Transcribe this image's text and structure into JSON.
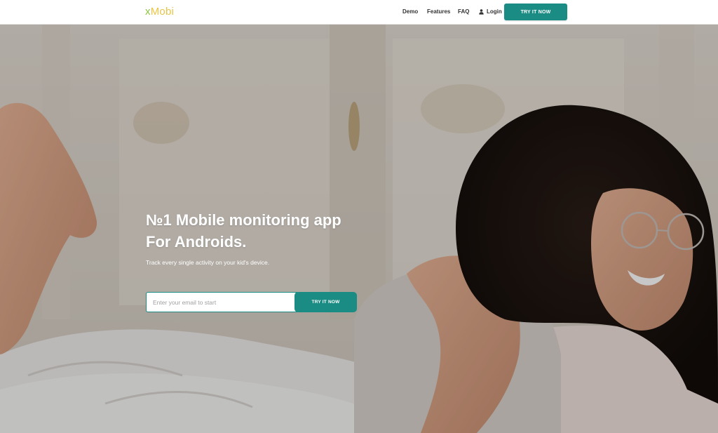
{
  "header": {
    "logo": {
      "x_letter": "x",
      "rest": "Mobi"
    },
    "nav": {
      "demo": "Demo",
      "features": "Features",
      "faq": "FAQ",
      "login": "Login"
    },
    "cta_label": "TRY IT NOW",
    "icons": {
      "login": "user-icon"
    }
  },
  "hero": {
    "title_line1": "№1 Mobile monitoring app",
    "title_line2": "For Androids.",
    "subtitle": "Track every single activity on your kid's device.",
    "email_placeholder": "Enter your email to start",
    "cta_label": "TRY IT NOW",
    "background": "photo of a smiling woman with glasses lying on a bed"
  },
  "colors": {
    "accent": "#1b8c84",
    "logo_x": "#8cc63f",
    "logo_rest": "#e8c547",
    "header_bg": "#ffffff"
  }
}
